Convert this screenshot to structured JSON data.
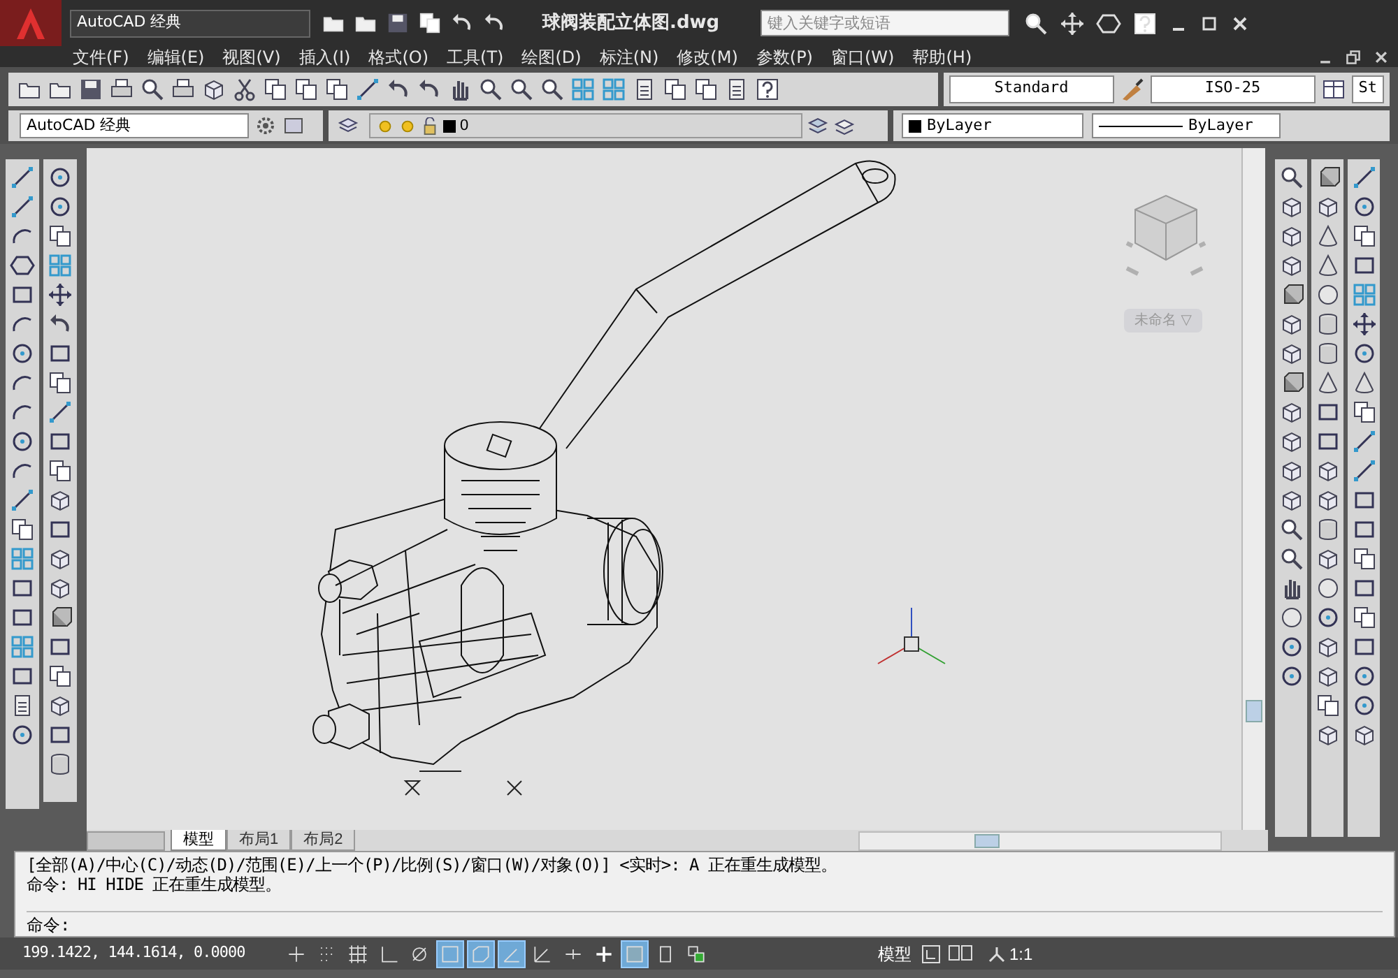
{
  "title_bar": {
    "workspace": "AutoCAD 经典",
    "title": "球阀装配立体图.dwg",
    "search": {
      "placeholder": "键入关键字或短语"
    }
  },
  "menu": [
    "文件(F)",
    "编辑(E)",
    "视图(V)",
    "插入(I)",
    "格式(O)",
    "工具(T)",
    "绘图(D)",
    "标注(N)",
    "修改(M)",
    "参数(P)",
    "窗口(W)",
    "帮助(H)"
  ],
  "styles_toolbar": {
    "text_style": "Standard",
    "dim_style": "ISO-25",
    "table_style": "St"
  },
  "layers_toolbar": {
    "workspace": "AutoCAD 经典",
    "layer": "0",
    "color_setting": "ByLayer",
    "linetype": "ByLayer"
  },
  "viewcube": {
    "view_name": "未命名 ▽"
  },
  "layout_tabs": [
    {
      "label": "模型",
      "selected": true
    },
    {
      "label": "布局1",
      "selected": false
    },
    {
      "label": "布局2",
      "selected": false
    }
  ],
  "command_lines": [
    "[全部(A)/中心(C)/动态(D)/范围(E)/上一个(P)/比例(S)/窗口(W)/对象(O)] <实时>: A 正在重生成模型。",
    "命令: HI HIDE 正在重生成模型。"
  ],
  "command_prompt": "命令:",
  "status_bar": {
    "coordinates": "199.1422, 144.1614, 0.0000",
    "toggles": [
      {
        "on": false
      },
      {
        "on": false
      },
      {
        "on": false
      },
      {
        "on": false
      },
      {
        "on": false
      },
      {
        "on": true
      },
      {
        "on": true
      },
      {
        "on": true
      },
      {
        "on": false
      },
      {
        "on": false
      },
      {
        "on": false
      },
      {
        "on": true
      },
      {
        "on": false
      },
      {
        "on": false
      }
    ],
    "space": "模型",
    "scale": "1:1"
  }
}
